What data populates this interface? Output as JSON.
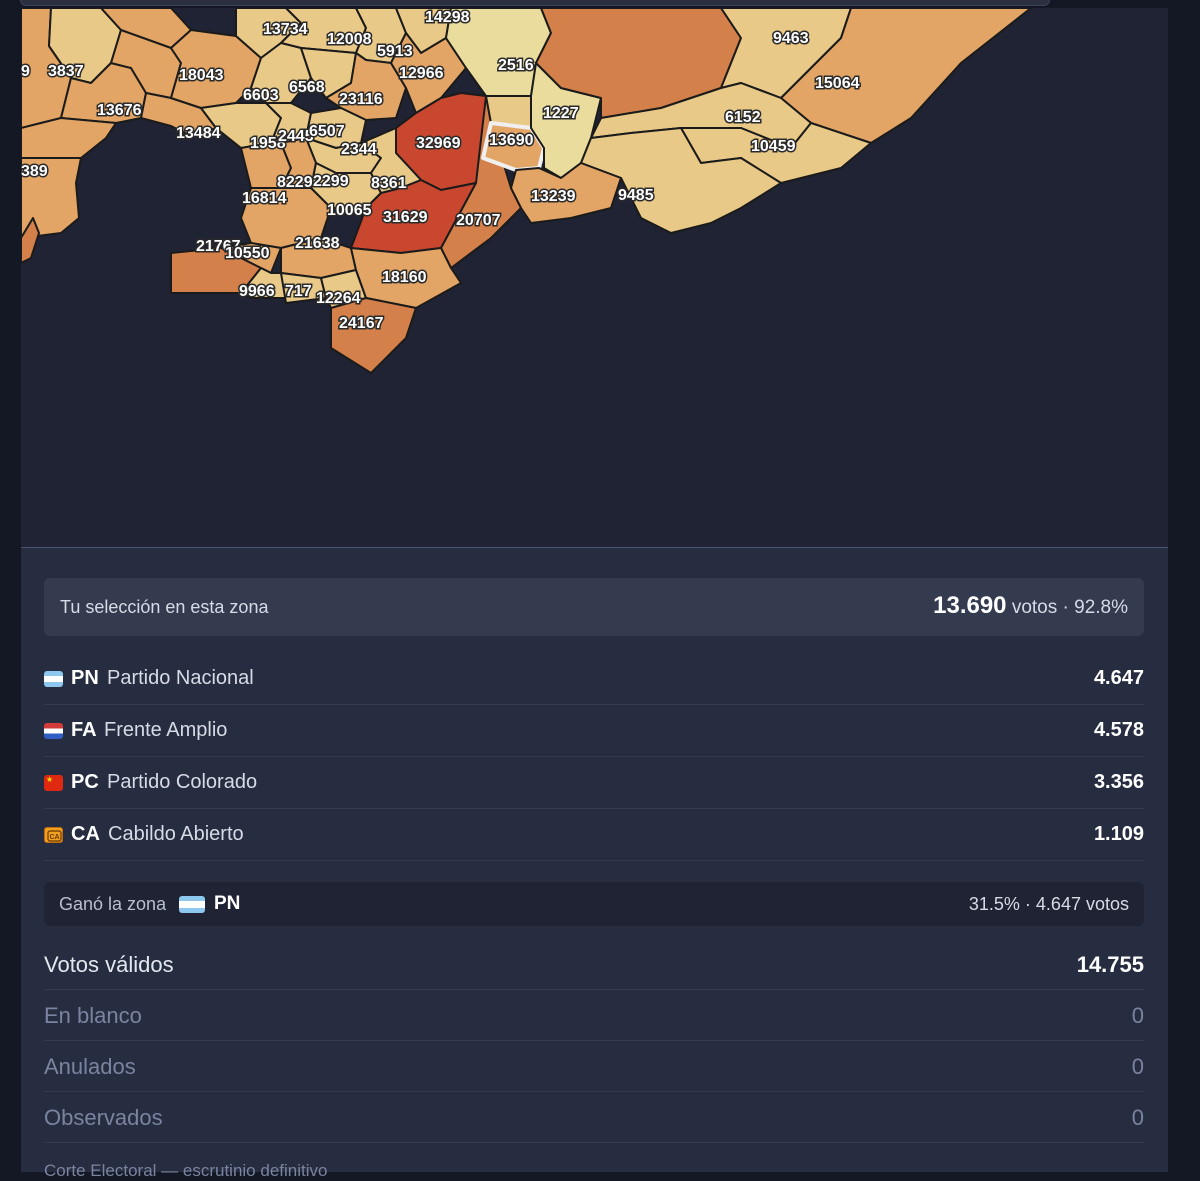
{
  "map": {
    "zones": [
      "13734",
      "12008",
      "5913",
      "14298",
      "2516",
      "9463",
      "3837",
      "18043",
      "6568",
      "6603",
      "23116",
      "12966",
      "15064",
      "13676",
      "13484",
      "1958",
      "2445",
      "6507",
      "2344",
      "32969",
      "13690",
      "1227",
      "6152",
      "10459",
      "389",
      "8229",
      "2299",
      "8361",
      "16814",
      "10065",
      "31629",
      "20707",
      "13239",
      "9485",
      "21767",
      "10550",
      "21638",
      "18160",
      "9966",
      "717",
      "12264",
      "24167",
      "9"
    ],
    "selected_zone": "13690"
  },
  "selection": {
    "label": "Tu selección en esta zona",
    "votes": "13.690",
    "votes_unit": "votos",
    "separator": "·",
    "percent": "92.8%"
  },
  "parties": [
    {
      "abbr": "PN",
      "name": "Partido Nacional",
      "votes": "4.647",
      "flag_icon": "uruguay-sky-blue-white-flag-icon"
    },
    {
      "abbr": "FA",
      "name": "Frente Amplio",
      "votes": "4.578",
      "flag_icon": "red-blue-white-flag-icon"
    },
    {
      "abbr": "PC",
      "name": "Partido Colorado",
      "votes": "3.356",
      "flag_icon": "red-star-flag-icon"
    },
    {
      "abbr": "CA",
      "name": "Cabildo Abierto",
      "votes": "1.109",
      "flag_icon": "ca-badge-icon"
    }
  ],
  "winner": {
    "label": "Ganó la zona",
    "party": "PN",
    "stats": "31.5% · 4.647 votos"
  },
  "totals": [
    {
      "label": "Votos válidos",
      "value": "14.755"
    },
    {
      "label": "En blanco",
      "value": "0"
    },
    {
      "label": "Anulados",
      "value": "0"
    },
    {
      "label": "Observados",
      "value": "0"
    }
  ],
  "footer": "Corte Electoral — escrutinio definitivo",
  "colors": {
    "highest": "#c9472e",
    "high": "#d4804a",
    "mid": "#e3a565",
    "low": "#e9c987",
    "lowest": "#e9dc9c",
    "selected_outline": "#f0f0f0"
  }
}
